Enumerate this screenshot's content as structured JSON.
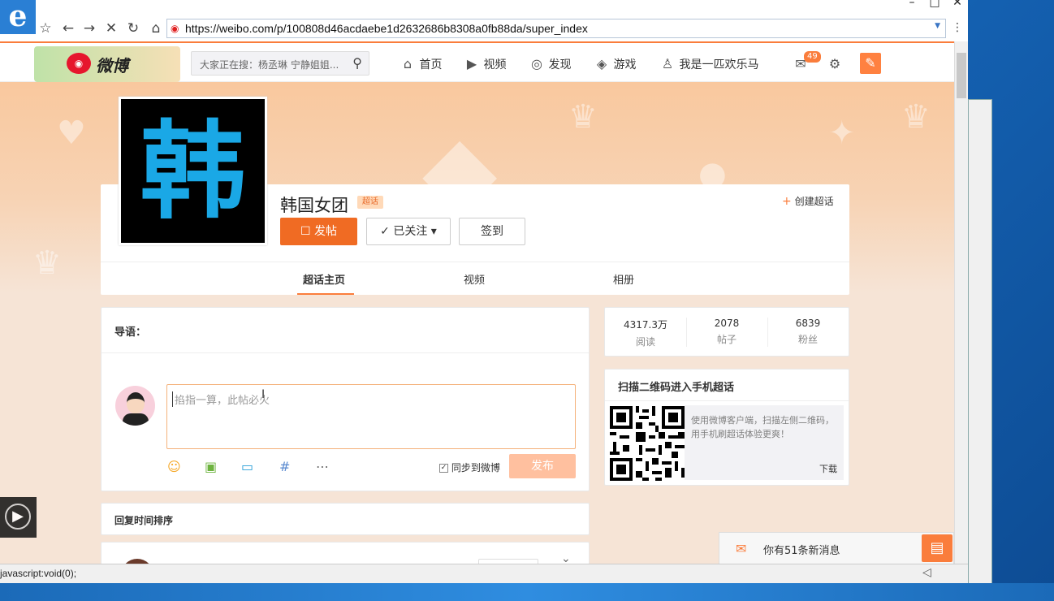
{
  "browser": {
    "url": "https://weibo.com/p/100808d46acdaebe1d2632686b8308a0fb88da/super_index",
    "status_text": "javascript:void(0);"
  },
  "weibo": {
    "logo_text": "微博",
    "search_placeholder": "大家正在搜：杨丞琳 宁静姐姐...",
    "nav": {
      "home": "首页",
      "video": "视频",
      "discover": "发现",
      "game": "游戏",
      "user": "我是一匹欢乐马"
    },
    "message_count": "49"
  },
  "topic": {
    "avatar_char": "韩",
    "title": "韩国女团",
    "badge": "超话",
    "create_label": "创建超话",
    "post_button": "发帖",
    "follow_button": "已关注",
    "signin_button": "签到",
    "tabs": [
      "超话主页",
      "视频",
      "相册"
    ]
  },
  "composer": {
    "guide_label": "导语：",
    "placeholder": "掐指一算，此帖必火",
    "sync_label": "同步到微博",
    "publish_button": "发布"
  },
  "sort_label": "回复时间排序",
  "stats": [
    {
      "value": "4317.3万",
      "label": "阅读"
    },
    {
      "value": "2078",
      "label": "帖子"
    },
    {
      "value": "6839",
      "label": "粉丝"
    }
  ],
  "qr": {
    "title": "扫描二维码进入手机超话",
    "desc": "使用微博客户端，扫描左侧二维码，用手机刷超话体验更爽！",
    "download": "下载"
  },
  "notice": "你有51条新消息"
}
